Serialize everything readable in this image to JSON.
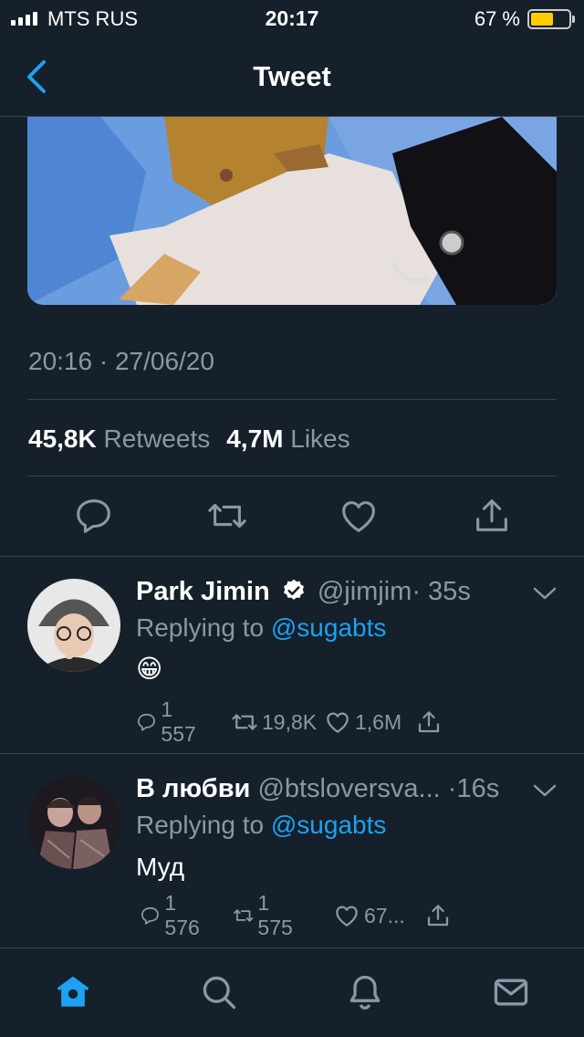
{
  "status_bar": {
    "carrier": "MTS RUS",
    "time": "20:17",
    "battery_percent": "67 %",
    "battery_level": 0.67
  },
  "header": {
    "title": "Tweet",
    "back_icon": "chevron-left-icon"
  },
  "tweet": {
    "timestamp": "20:16 · 27/06/20",
    "retweets_count": "45,8K",
    "retweets_label": "Retweets",
    "likes_count": "4,7M",
    "likes_label": "Likes",
    "actions": [
      "reply-icon",
      "retweet-icon",
      "like-icon",
      "share-icon"
    ]
  },
  "replies": [
    {
      "name": "Park Jimin",
      "verified": true,
      "handle": "@jimjim",
      "time": "· 35s",
      "replying_prefix": "Replying to",
      "replying_to": "@sugabts",
      "body": "😁",
      "reply_count": "1 557",
      "retweet_count": "19,8K",
      "like_count": "1,6M"
    },
    {
      "name": "В любви",
      "verified": false,
      "handle": "@btsloversva...",
      "time": "·16s",
      "replying_prefix": "Replying to",
      "replying_to": "@sugabts",
      "body": "Муд",
      "reply_count": "1 576",
      "retweet_count": "1 575",
      "like_count": "67..."
    }
  ],
  "tabbar": {
    "tabs": [
      "home-icon",
      "search-icon",
      "notifications-icon",
      "messages-icon"
    ]
  },
  "colors": {
    "background": "#15202b",
    "accent": "#1da1f2",
    "secondary_text": "#8899a6",
    "divider": "#38444d"
  }
}
